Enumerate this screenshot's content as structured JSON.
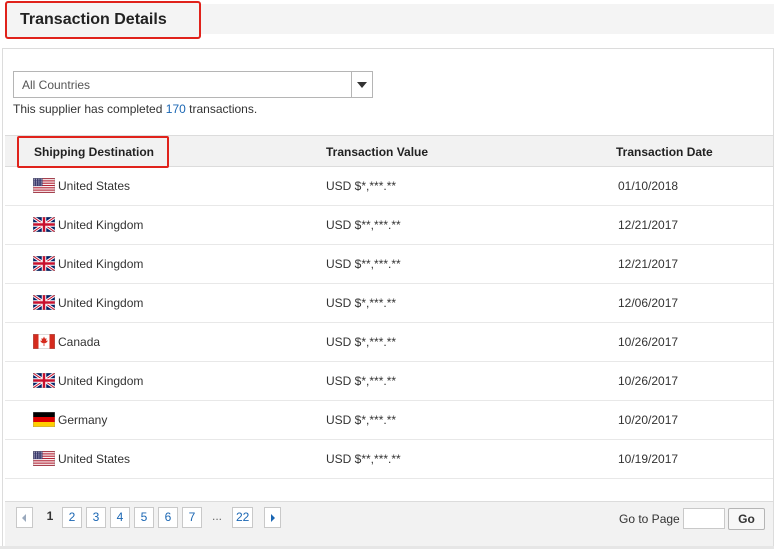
{
  "header": {
    "title": "Transaction Details"
  },
  "filter": {
    "selected": "All Countries"
  },
  "summary": {
    "prefix": "This supplier has completed",
    "count": "170",
    "suffix": "transactions."
  },
  "table": {
    "columns": [
      "Shipping Destination",
      "Transaction Value",
      "Transaction Date"
    ],
    "rows": [
      {
        "flag": "us-flag-icon",
        "country": "United States",
        "value": "USD $*,***.**",
        "date": "01/10/2018"
      },
      {
        "flag": "uk-flag-icon",
        "country": "United Kingdom",
        "value": "USD $**,***.**",
        "date": "12/21/2017"
      },
      {
        "flag": "uk-flag-icon",
        "country": "United Kingdom",
        "value": "USD $**,***.**",
        "date": "12/21/2017"
      },
      {
        "flag": "uk-flag-icon",
        "country": "United Kingdom",
        "value": "USD $*,***.**",
        "date": "12/06/2017"
      },
      {
        "flag": "ca-flag-icon",
        "country": "Canada",
        "value": "USD $*,***.**",
        "date": "10/26/2017"
      },
      {
        "flag": "uk-flag-icon",
        "country": "United Kingdom",
        "value": "USD $*,***.**",
        "date": "10/26/2017"
      },
      {
        "flag": "de-flag-icon",
        "country": "Germany",
        "value": "USD $*,***.**",
        "date": "10/20/2017"
      },
      {
        "flag": "us-flag-icon",
        "country": "United States",
        "value": "USD $**,***.**",
        "date": "10/19/2017"
      }
    ]
  },
  "pagination": {
    "current": "1",
    "pages": [
      "2",
      "3",
      "4",
      "5",
      "6",
      "7"
    ],
    "ellipsis": "...",
    "last": "22",
    "goto_label": "Go to Page",
    "goto_value": "",
    "go_label": "Go"
  },
  "colors": {
    "accent": "#1a66b3",
    "highlight": "#e0221b",
    "header_bg": "#f2f2f2"
  }
}
